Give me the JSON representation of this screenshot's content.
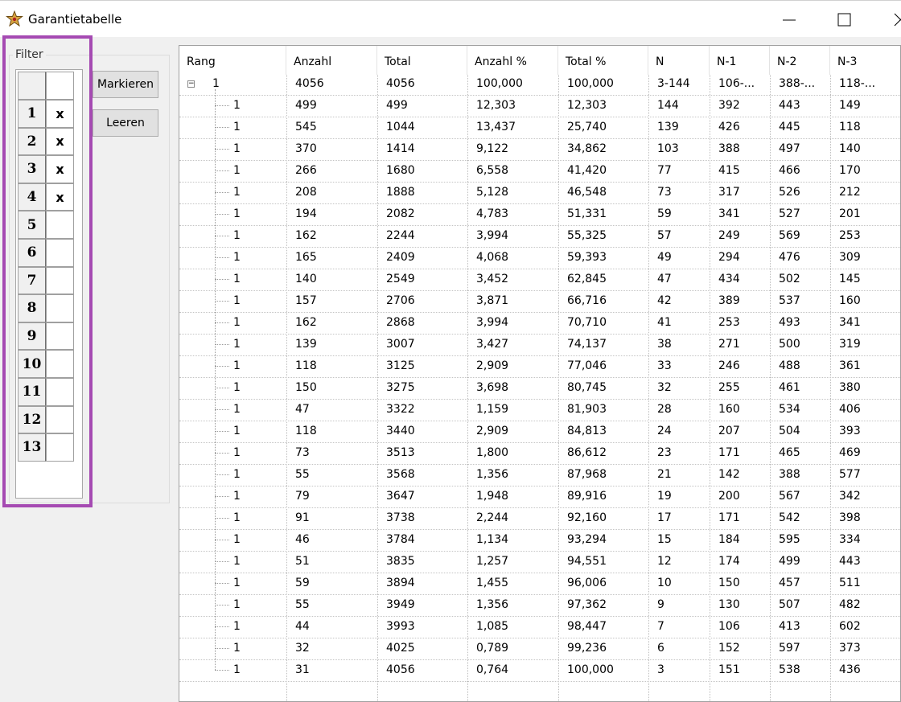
{
  "window": {
    "title": "Garantietabelle",
    "icon": "app-star-icon",
    "controls": [
      "minimize-icon",
      "maximize-icon",
      "close-icon"
    ]
  },
  "filter": {
    "legend": "Filter",
    "rows": [
      {
        "num": "1",
        "mark": "x"
      },
      {
        "num": "2",
        "mark": "x"
      },
      {
        "num": "3",
        "mark": "x"
      },
      {
        "num": "4",
        "mark": "x"
      },
      {
        "num": "5",
        "mark": ""
      },
      {
        "num": "6",
        "mark": ""
      },
      {
        "num": "7",
        "mark": ""
      },
      {
        "num": "8",
        "mark": ""
      },
      {
        "num": "9",
        "mark": ""
      },
      {
        "num": "10",
        "mark": ""
      },
      {
        "num": "11",
        "mark": ""
      },
      {
        "num": "12",
        "mark": ""
      },
      {
        "num": "13",
        "mark": ""
      }
    ],
    "highlight_color": "#a54ab2"
  },
  "buttons": {
    "mark": "Markieren",
    "clear": "Leeren"
  },
  "grid": {
    "columns": [
      "Rang",
      "Anzahl",
      "Total",
      "Anzahl %",
      "Total %",
      "N",
      "N-1",
      "N-2",
      "N-3"
    ],
    "parent": [
      "1",
      "4056",
      "4056",
      "100,000",
      "100,000",
      "3-144",
      "106-...",
      "388-...",
      "118-..."
    ],
    "expand_symbol": "−",
    "rows": [
      [
        "1",
        "499",
        "499",
        "12,303",
        "12,303",
        "144",
        "392",
        "443",
        "149"
      ],
      [
        "1",
        "545",
        "1044",
        "13,437",
        "25,740",
        "139",
        "426",
        "445",
        "118"
      ],
      [
        "1",
        "370",
        "1414",
        "9,122",
        "34,862",
        "103",
        "388",
        "497",
        "140"
      ],
      [
        "1",
        "266",
        "1680",
        "6,558",
        "41,420",
        "77",
        "415",
        "466",
        "170"
      ],
      [
        "1",
        "208",
        "1888",
        "5,128",
        "46,548",
        "73",
        "317",
        "526",
        "212"
      ],
      [
        "1",
        "194",
        "2082",
        "4,783",
        "51,331",
        "59",
        "341",
        "527",
        "201"
      ],
      [
        "1",
        "162",
        "2244",
        "3,994",
        "55,325",
        "57",
        "249",
        "569",
        "253"
      ],
      [
        "1",
        "165",
        "2409",
        "4,068",
        "59,393",
        "49",
        "294",
        "476",
        "309"
      ],
      [
        "1",
        "140",
        "2549",
        "3,452",
        "62,845",
        "47",
        "434",
        "502",
        "145"
      ],
      [
        "1",
        "157",
        "2706",
        "3,871",
        "66,716",
        "42",
        "389",
        "537",
        "160"
      ],
      [
        "1",
        "162",
        "2868",
        "3,994",
        "70,710",
        "41",
        "253",
        "493",
        "341"
      ],
      [
        "1",
        "139",
        "3007",
        "3,427",
        "74,137",
        "38",
        "271",
        "500",
        "319"
      ],
      [
        "1",
        "118",
        "3125",
        "2,909",
        "77,046",
        "33",
        "246",
        "488",
        "361"
      ],
      [
        "1",
        "150",
        "3275",
        "3,698",
        "80,745",
        "32",
        "255",
        "461",
        "380"
      ],
      [
        "1",
        "47",
        "3322",
        "1,159",
        "81,903",
        "28",
        "160",
        "534",
        "406"
      ],
      [
        "1",
        "118",
        "3440",
        "2,909",
        "84,813",
        "24",
        "207",
        "504",
        "393"
      ],
      [
        "1",
        "73",
        "3513",
        "1,800",
        "86,612",
        "23",
        "171",
        "465",
        "469"
      ],
      [
        "1",
        "55",
        "3568",
        "1,356",
        "87,968",
        "21",
        "142",
        "388",
        "577"
      ],
      [
        "1",
        "79",
        "3647",
        "1,948",
        "89,916",
        "19",
        "200",
        "567",
        "342"
      ],
      [
        "1",
        "91",
        "3738",
        "2,244",
        "92,160",
        "17",
        "171",
        "542",
        "398"
      ],
      [
        "1",
        "46",
        "3784",
        "1,134",
        "93,294",
        "15",
        "184",
        "595",
        "334"
      ],
      [
        "1",
        "51",
        "3835",
        "1,257",
        "94,551",
        "12",
        "174",
        "499",
        "443"
      ],
      [
        "1",
        "59",
        "3894",
        "1,455",
        "96,006",
        "10",
        "150",
        "457",
        "511"
      ],
      [
        "1",
        "55",
        "3949",
        "1,356",
        "97,362",
        "9",
        "130",
        "507",
        "482"
      ],
      [
        "1",
        "44",
        "3993",
        "1,085",
        "98,447",
        "7",
        "106",
        "413",
        "602"
      ],
      [
        "1",
        "32",
        "4025",
        "0,789",
        "99,236",
        "6",
        "152",
        "597",
        "373"
      ],
      [
        "1",
        "31",
        "4056",
        "0,764",
        "100,000",
        "3",
        "151",
        "538",
        "436"
      ]
    ]
  }
}
